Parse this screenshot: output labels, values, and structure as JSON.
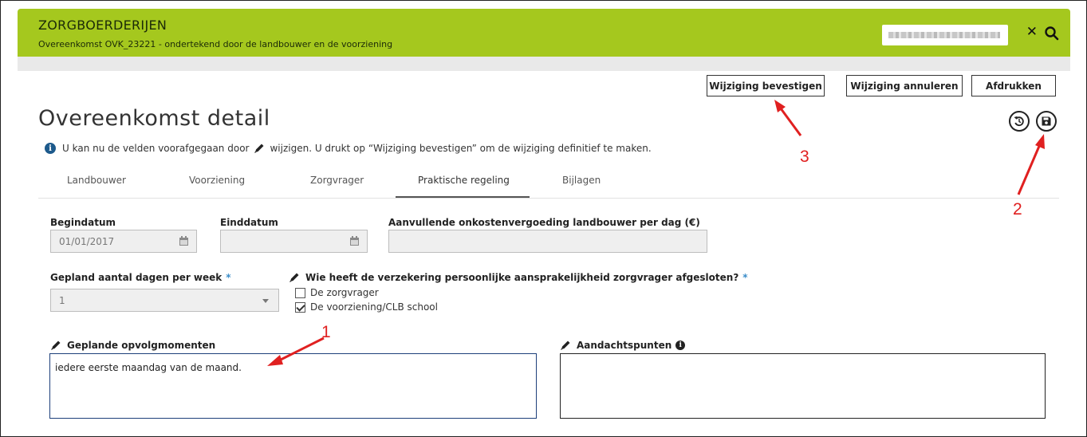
{
  "header": {
    "title": "ZORGBOERDERIJEN",
    "subtitle": "Overeenkomst OVK_23221 - ondertekend door de landbouwer en de voorziening",
    "brand_color": "#a5c81e"
  },
  "toolbar": {
    "confirm_label": "Wijziging bevestigen",
    "cancel_label": "Wijziging annuleren",
    "print_label": "Afdrukken"
  },
  "page": {
    "title": "Overeenkomst detail",
    "info_before": "U kan nu de velden voorafgegaan door",
    "info_after": "wijzigen. U drukt op “Wijziging bevestigen” om de wijziging definitief te maken."
  },
  "tabs": [
    {
      "label": "Landbouwer"
    },
    {
      "label": "Voorziening"
    },
    {
      "label": "Zorgvrager"
    },
    {
      "label": "Praktische regeling",
      "active": true
    },
    {
      "label": "Bijlagen"
    }
  ],
  "form": {
    "begindatum_label": "Begindatum",
    "begindatum_value": "01/01/2017",
    "einddatum_label": "Einddatum",
    "einddatum_value": "",
    "onkosten_label": "Aanvullende onkostenvergoeding landbouwer per dag (€)",
    "onkosten_value": "",
    "dagen_label": "Gepland aantal dagen per week",
    "dagen_value": "1",
    "required_marker": "*",
    "verzekering_label": "Wie heeft de verzekering persoonlijke aansprakelijkheid zorgvrager afgesloten?",
    "verzekering_options": [
      {
        "label": "De zorgvrager",
        "checked": false
      },
      {
        "label": "De voorziening/CLB school",
        "checked": true
      }
    ],
    "opvolg_label": "Geplande opvolgmomenten",
    "opvolg_value": "iedere eerste maandag van de maand.",
    "aandacht_label": "Aandachtspunten",
    "aandacht_value": ""
  },
  "annotations": {
    "one": "1",
    "two": "2",
    "three": "3",
    "color": "#e02020"
  }
}
